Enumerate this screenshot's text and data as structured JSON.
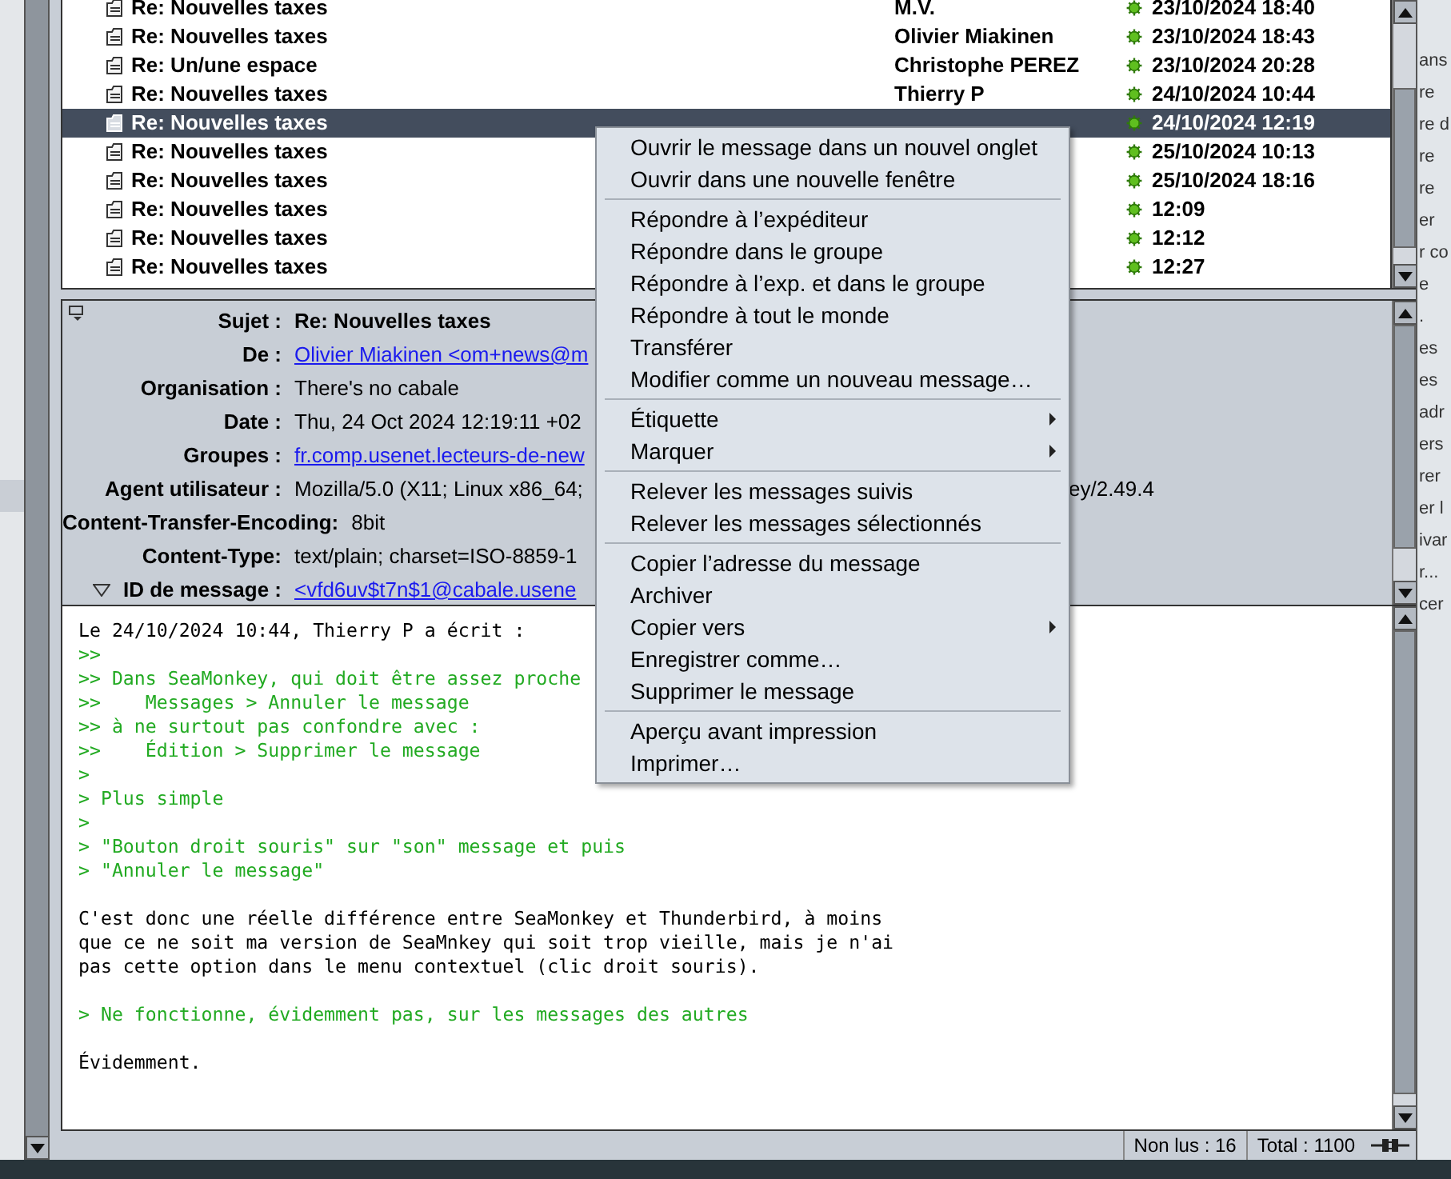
{
  "thread_list": {
    "rows": [
      {
        "subject": "Re: Nouvelles taxes",
        "author": "M.V.",
        "date": "23/10/2024 18:40",
        "selected": false
      },
      {
        "subject": "Re: Nouvelles taxes",
        "author": "Olivier Miakinen",
        "date": "23/10/2024 18:43",
        "selected": false
      },
      {
        "subject": "Re: Un/une espace",
        "author": "Christophe PEREZ",
        "date": "23/10/2024 20:28",
        "selected": false
      },
      {
        "subject": "Re: Nouvelles taxes",
        "author": "Thierry P",
        "date": "24/10/2024 10:44",
        "selected": false
      },
      {
        "subject": "Re: Nouvelles taxes",
        "date": "24/10/2024 12:19",
        "selected": true
      },
      {
        "subject": "Re: Nouvelles taxes",
        "date": "25/10/2024 10:13",
        "selected": false
      },
      {
        "subject": "Re: Nouvelles taxes",
        "date": "25/10/2024 18:16",
        "selected": false
      },
      {
        "subject": "Re: Nouvelles taxes",
        "date": "12:09",
        "selected": false
      },
      {
        "subject": "Re: Nouvelles taxes",
        "date": "12:12",
        "selected": false
      },
      {
        "subject": "Re: Nouvelles taxes",
        "date": "12:27",
        "selected": false
      }
    ]
  },
  "header": {
    "fields": [
      {
        "label": "Sujet :",
        "value": "Re: Nouvelles taxes",
        "kind": "bold"
      },
      {
        "label": "De :",
        "value": "Olivier Miakinen <om+news@m",
        "kind": "link"
      },
      {
        "label": "Organisation :",
        "value": "There's no cabale",
        "kind": "plain"
      },
      {
        "label": "Date :",
        "value": "Thu, 24 Oct 2024 12:19:11 +02",
        "kind": "plain"
      },
      {
        "label": "Groupes :",
        "value": "fr.comp.usenet.lecteurs-de-new",
        "kind": "link"
      },
      {
        "label": "Agent utilisateur :",
        "value": "Mozilla/5.0 (X11; Linux x86_64;",
        "tail": "ey/2.49.4",
        "kind": "plain"
      },
      {
        "label": "Content-Transfer-Encoding:",
        "value": "8bit",
        "kind": "plain"
      },
      {
        "label": "Content-Type:",
        "value": "text/plain; charset=ISO-8859-1",
        "kind": "plain"
      },
      {
        "label": "ID de message :",
        "value": "<vfd6uv$t7n$1@cabale.usene",
        "kind": "link",
        "expanded": true
      }
    ]
  },
  "body": {
    "lines": [
      {
        "kind": "text",
        "text": "Le 24/10/2024 10:44, Thierry P a écrit :"
      },
      {
        "kind": "quote",
        "text": ">>"
      },
      {
        "kind": "quote",
        "text": ">> Dans SeaMonkey, qui doit être assez proche"
      },
      {
        "kind": "quote",
        "text": ">>    Messages > Annuler le message"
      },
      {
        "kind": "quote",
        "text": ">> à ne surtout pas confondre avec :"
      },
      {
        "kind": "quote",
        "text": ">>    Édition > Supprimer le message"
      },
      {
        "kind": "quote",
        "text": ">"
      },
      {
        "kind": "quote",
        "text": "> Plus simple"
      },
      {
        "kind": "quote",
        "text": ">"
      },
      {
        "kind": "quote",
        "text": "> \"Bouton droit souris\" sur \"son\" message et puis"
      },
      {
        "kind": "quote",
        "text": "> \"Annuler le message\""
      },
      {
        "kind": "blank"
      },
      {
        "kind": "text",
        "text": "C'est donc une réelle différence entre SeaMonkey et Thunderbird, à moins"
      },
      {
        "kind": "text",
        "text": "que ce ne soit ma version de SeaMnkey qui soit trop vieille, mais je n'ai"
      },
      {
        "kind": "text",
        "text": "pas cette option dans le menu contextuel (clic droit souris)."
      },
      {
        "kind": "blank"
      },
      {
        "kind": "quote",
        "text": "> Ne fonctionne, évidemment pas, sur les messages des autres"
      },
      {
        "kind": "blank"
      },
      {
        "kind": "text",
        "text": "Évidemment."
      }
    ]
  },
  "context_menu": {
    "items": [
      {
        "kind": "item",
        "label": "Ouvrir le message dans un nouvel onglet"
      },
      {
        "kind": "item",
        "label": "Ouvrir dans une nouvelle fenêtre"
      },
      {
        "kind": "separator"
      },
      {
        "kind": "item",
        "label": "Répondre à l’expéditeur"
      },
      {
        "kind": "item",
        "label": "Répondre dans le groupe"
      },
      {
        "kind": "item",
        "label": "Répondre à l’exp. et dans le groupe"
      },
      {
        "kind": "item",
        "label": "Répondre à tout le monde"
      },
      {
        "kind": "item",
        "label": "Transférer"
      },
      {
        "kind": "item",
        "label": "Modifier comme un nouveau message…"
      },
      {
        "kind": "separator"
      },
      {
        "kind": "submenu",
        "label": "Étiquette"
      },
      {
        "kind": "submenu",
        "label": "Marquer"
      },
      {
        "kind": "separator"
      },
      {
        "kind": "item",
        "label": "Relever les messages suivis"
      },
      {
        "kind": "item",
        "label": "Relever les messages sélectionnés"
      },
      {
        "kind": "separator"
      },
      {
        "kind": "item",
        "label": "Copier l’adresse du message"
      },
      {
        "kind": "item",
        "label": "Archiver"
      },
      {
        "kind": "submenu",
        "label": "Copier vers"
      },
      {
        "kind": "item",
        "label": "Enregistrer comme…"
      },
      {
        "kind": "item",
        "label": "Supprimer le message"
      },
      {
        "kind": "separator"
      },
      {
        "kind": "item",
        "label": "Aperçu avant impression"
      },
      {
        "kind": "item",
        "label": "Imprimer…"
      }
    ]
  },
  "status_bar": {
    "unread": "Non lus : 16",
    "total": "Total : 1100"
  },
  "background_window": {
    "fragments": [
      "ans",
      "re",
      "re d",
      "re",
      "re",
      "er",
      "r co",
      "e",
      ".",
      "es",
      "es",
      "adr",
      "ers",
      "rer",
      "er l",
      "ivar",
      "r...",
      "cer"
    ]
  }
}
